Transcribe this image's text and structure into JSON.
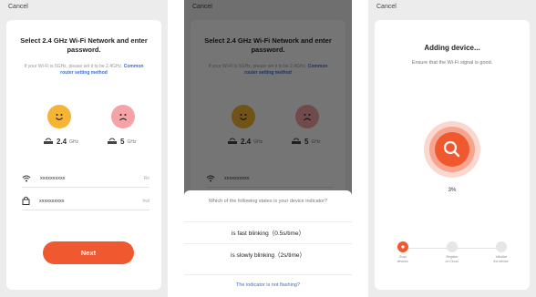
{
  "panel1": {
    "cancel": "Cancel",
    "title": "Select 2.4 GHz Wi-Fi Network and enter password.",
    "subtitle": "If your Wi-Fi is 5GHz, please set it to be 2.4GHz.",
    "link": "Common router setting method",
    "band_24": "2.4",
    "band_24_unit": "GHz",
    "band_5": "5",
    "band_5_unit": "GHz",
    "wifi_value": "xxxxxxxxxx",
    "wifi_aux": "Re",
    "password_value": "xxxxxxxxxx",
    "password_aux": "hwl",
    "next_label": "Next"
  },
  "panel2": {
    "cancel": "Cancel",
    "title": "Select 2.4 GHz Wi-Fi Network and enter password.",
    "subtitle": "If your Wi-Fi is 5GHz, please set it to be 2.4GHz.",
    "link": "Common router setting method",
    "band_24": "2.4",
    "band_24_unit": "GHz",
    "band_5": "5",
    "band_5_unit": "GHz",
    "wifi_value": "xxxxxxxxxx",
    "question": "Which of the following states is your device indicator?",
    "option_fast": "is fast blinking（0.5s/time）",
    "option_slow": "is slowly blinking（2s/time）",
    "help_link": "The indicator is not flashing?"
  },
  "panel3": {
    "cancel": "Cancel",
    "title": "Adding device...",
    "subtitle": "Ensure that the Wi-Fi signal is good.",
    "progress_percent": "3%",
    "progress_value": 0.03,
    "steps": [
      {
        "label_1": "Scan",
        "label_2": "devices."
      },
      {
        "label_1": "Register",
        "label_2": "on Cloud."
      },
      {
        "label_1": "Initialize",
        "label_2": "the device."
      }
    ]
  },
  "colors": {
    "accent": "#f0592f",
    "link": "#3a6fd8",
    "happy_face": "#f5b434",
    "sad_face": "#f5a3a6"
  }
}
